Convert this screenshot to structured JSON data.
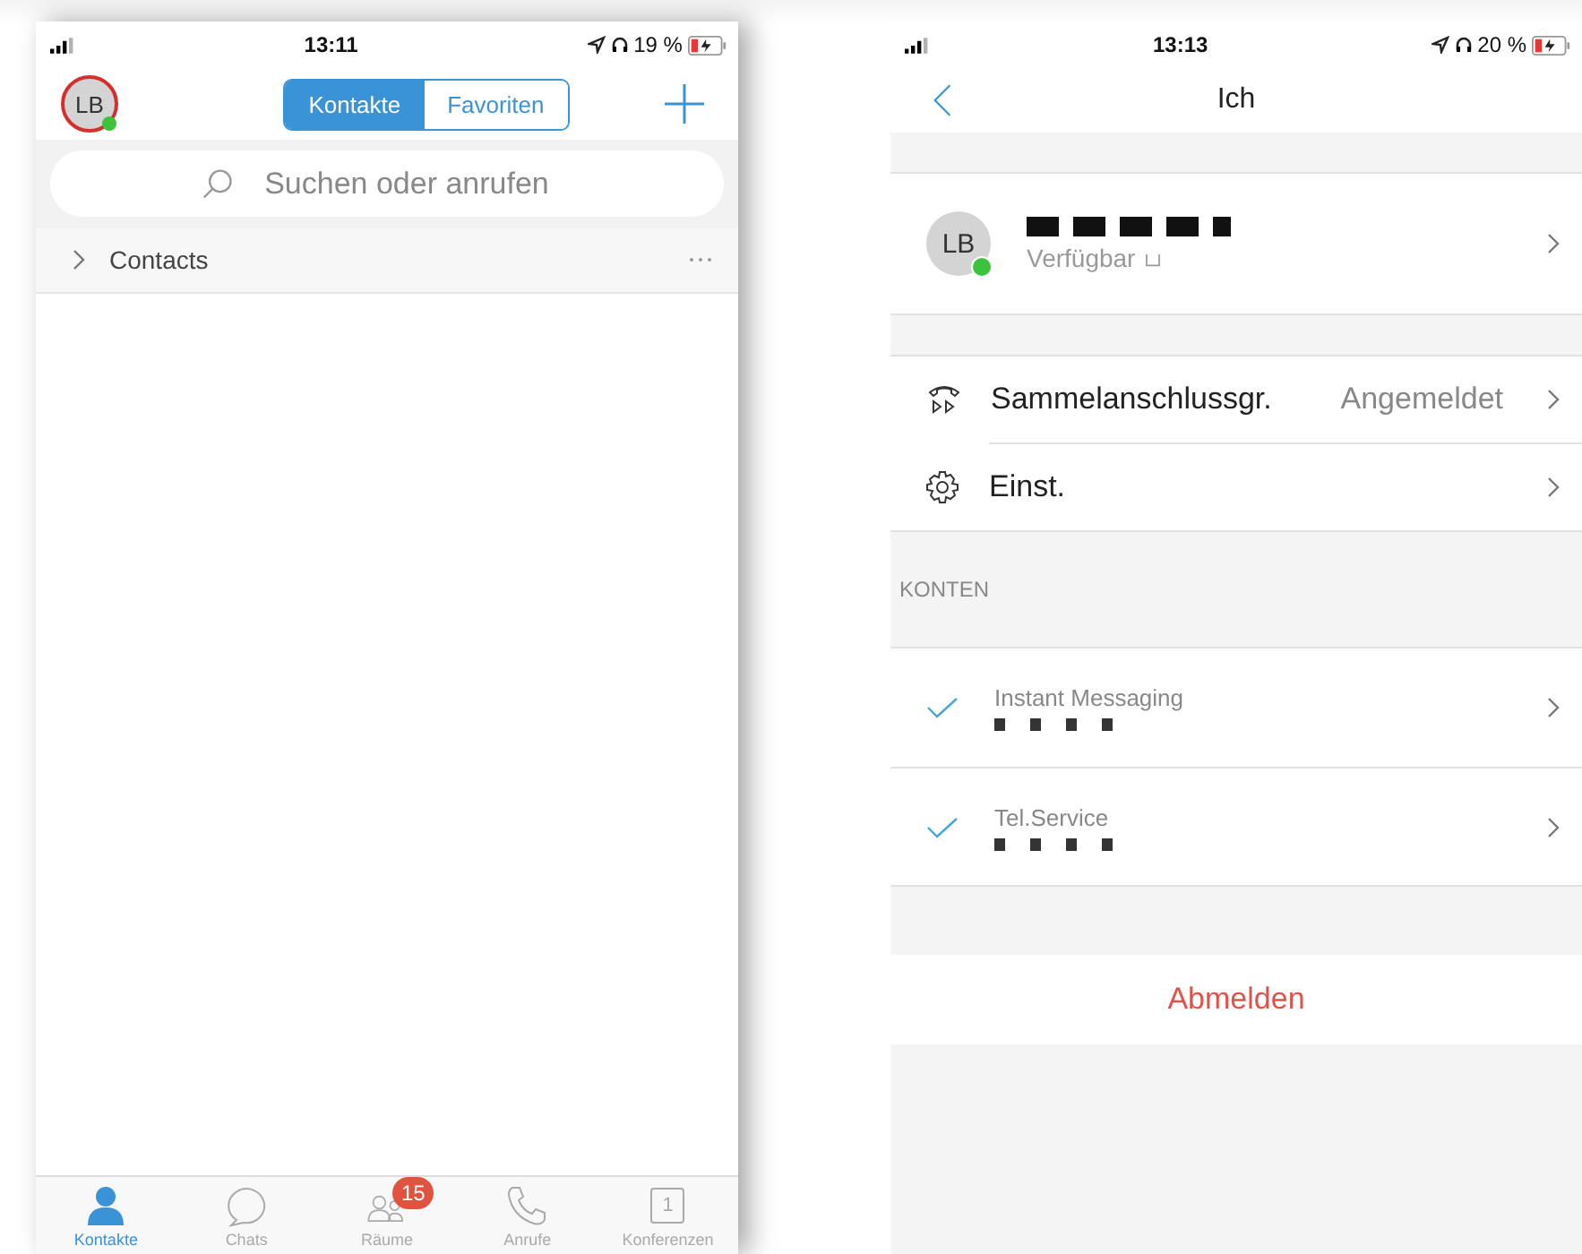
{
  "left_phone": {
    "status_bar": {
      "time": "13:11",
      "battery": "19 %"
    },
    "avatar": {
      "initials": "LB",
      "online": true
    },
    "segments": [
      {
        "label": "Kontakte",
        "selected": true
      },
      {
        "label": "Favoriten",
        "selected": false
      }
    ],
    "search": {
      "placeholder": "Suchen oder anrufen"
    },
    "groups": [
      {
        "label": "Contacts",
        "expanded": false
      }
    ],
    "tab_bar": [
      {
        "label": "Kontakte",
        "selected": true
      },
      {
        "label": "Chats",
        "selected": false
      },
      {
        "label": "Räume",
        "selected": false,
        "badge": "15"
      },
      {
        "label": "Anrufe",
        "selected": false
      },
      {
        "label": "Konferenzen",
        "selected": false,
        "day": "1"
      }
    ]
  },
  "right_phone": {
    "status_bar": {
      "time": "13:13",
      "battery": "20 %"
    },
    "title": "Ich",
    "profile": {
      "initials": "LB",
      "online": true,
      "status": "Verfügbar"
    },
    "settings": [
      {
        "label": "Sammelanschlussgr.",
        "value": "Angemeldet"
      },
      {
        "label": "Einst."
      }
    ],
    "section_header": "KONTEN",
    "accounts": [
      {
        "label": "Instant Messaging",
        "checked": true
      },
      {
        "label": "Tel.Service",
        "checked": true
      }
    ],
    "logout": "Abmelden"
  }
}
